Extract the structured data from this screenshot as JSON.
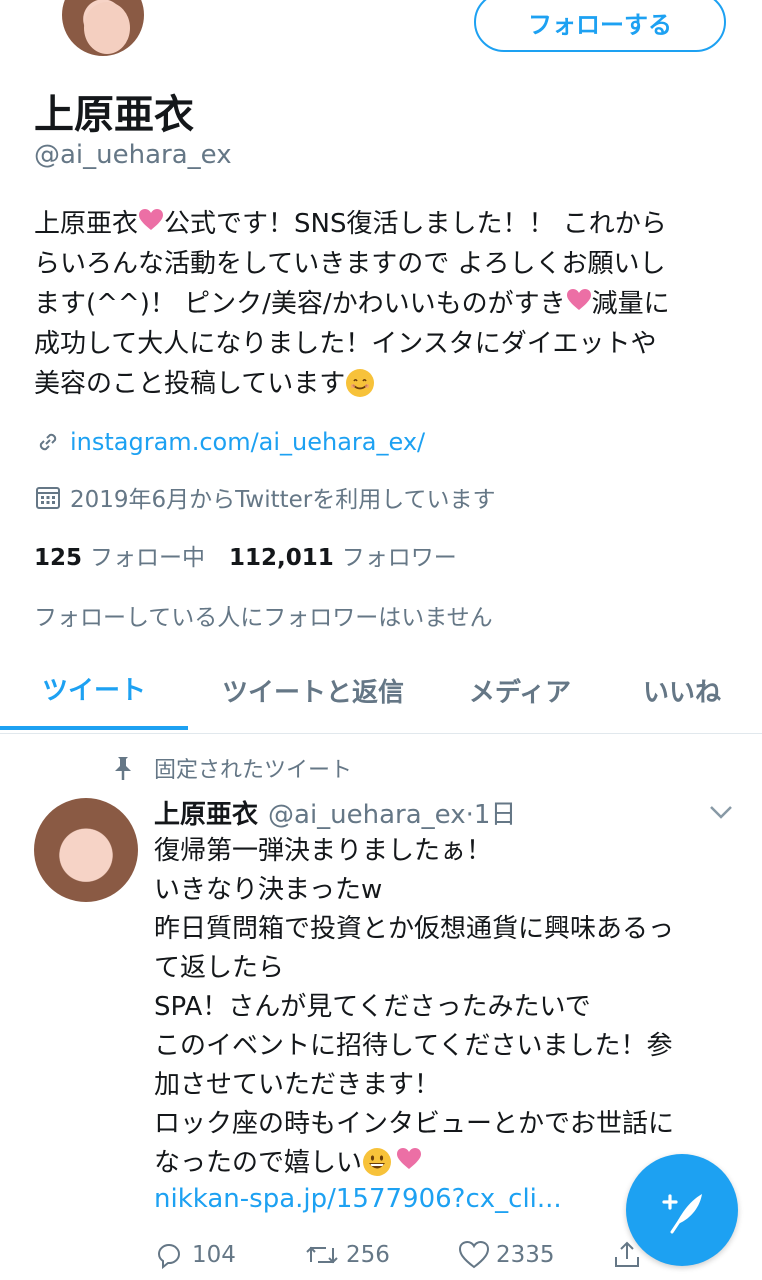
{
  "profile": {
    "display_name": "上原亜衣",
    "handle": "@ai_uehara_ex",
    "follow_button": "フォローする",
    "bio_lines": [
      "上原亜衣",
      "公式です！SNS復活しました！！ これから",
      "らいろんな活動をしていきますので よろしくお願いし",
      "ます(^^)！ ピンク/美容/かわいいものがすき",
      "減量に",
      "成功して大人になりました！インスタにダイエットや",
      "美容のこと投稿しています"
    ],
    "link": "instagram.com/ai_uehara_ex/",
    "joined": "2019年6月からTwitterを利用しています",
    "following_count": "125",
    "following_label": "フォロー中",
    "followers_count": "112,011",
    "followers_label": "フォロワー",
    "followers_note": "フォローしている人にフォロワーはいません"
  },
  "tabs": [
    {
      "label": "ツイート",
      "active": true
    },
    {
      "label": "ツイートと返信",
      "active": false
    },
    {
      "label": "メディア",
      "active": false
    },
    {
      "label": "いいね",
      "active": false
    }
  ],
  "pinned_tweet": {
    "pinned_label": "固定されたツイート",
    "author_name": "上原亜衣",
    "author_handle": "@ai_uehara_ex",
    "time": "·1日",
    "lines": [
      "復帰第一弾決まりましたぁ！",
      "いきなり決まったw",
      "昨日質問箱で投資とか仮想通貨に興味あるっ",
      "て返したら",
      "SPA！さんが見てくださったみたいで",
      "このイベントに招待してくださいました！参",
      "加させていただきます！",
      "ロック座の時もインタビューとかでお世話に",
      "なったので嬉しい"
    ],
    "link": "nikkan-spa.jp/1577906?cx_cli...",
    "reply_count": "104",
    "retweet_count": "256",
    "like_count": "2335"
  },
  "colors": {
    "accent": "#1da1f2",
    "secondary_text": "#657786",
    "heart_pink": "#ec6fa5"
  },
  "icons": [
    "link-icon",
    "calendar-icon",
    "pin-icon",
    "chevron-down-icon",
    "reply-icon",
    "retweet-icon",
    "like-icon",
    "share-icon",
    "compose-icon"
  ]
}
